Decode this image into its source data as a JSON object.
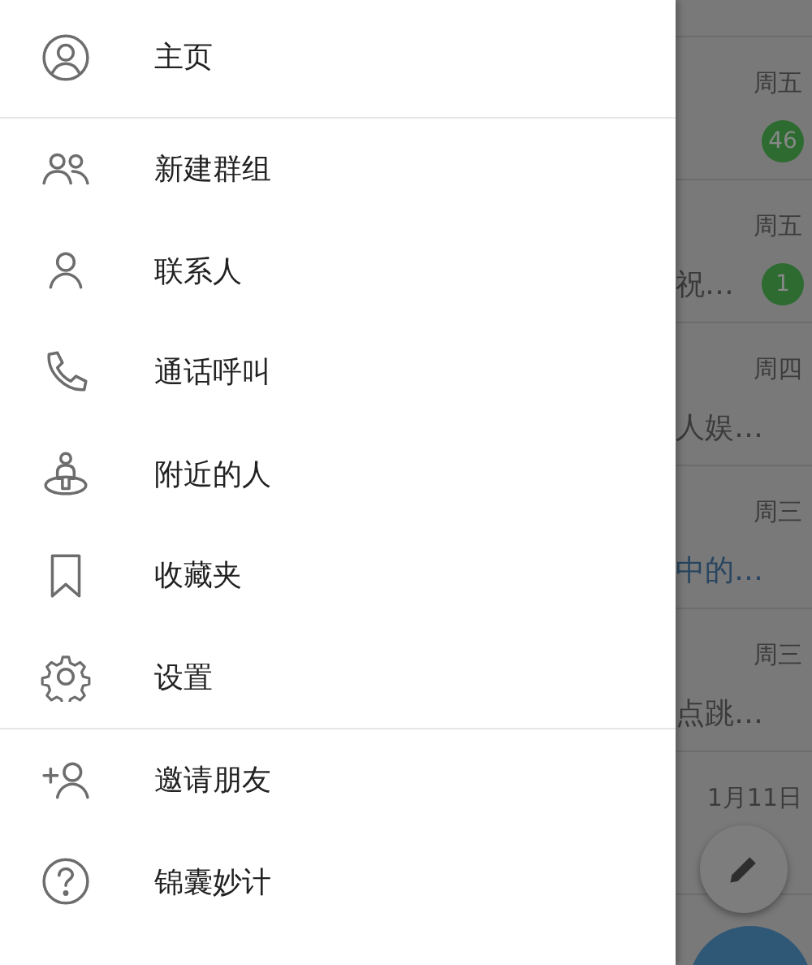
{
  "drawer": {
    "sections": [
      [
        {
          "kind": "home",
          "label": "主页"
        }
      ],
      [
        {
          "kind": "group",
          "label": "新建群组"
        },
        {
          "kind": "contact",
          "label": "联系人"
        },
        {
          "kind": "call",
          "label": "通话呼叫"
        },
        {
          "kind": "nearby",
          "label": "附近的人"
        },
        {
          "kind": "saved",
          "label": "收藏夹"
        },
        {
          "kind": "settings",
          "label": "设置"
        }
      ],
      [
        {
          "kind": "invite",
          "label": "邀请朋友"
        },
        {
          "kind": "help",
          "label": "锦囊妙计"
        }
      ]
    ]
  },
  "chat_list": {
    "rows": [
      {
        "time": "周五",
        "badge": "46"
      },
      {
        "time": "周五",
        "snippet": "祝…",
        "badge": "1"
      },
      {
        "time": "周四",
        "snippet": "人娱…"
      },
      {
        "time": "周三",
        "snippet": "中的…",
        "highlighted": true
      },
      {
        "time": "周三",
        "snippet": "点跳…"
      },
      {
        "time": "1月11日"
      }
    ]
  }
}
